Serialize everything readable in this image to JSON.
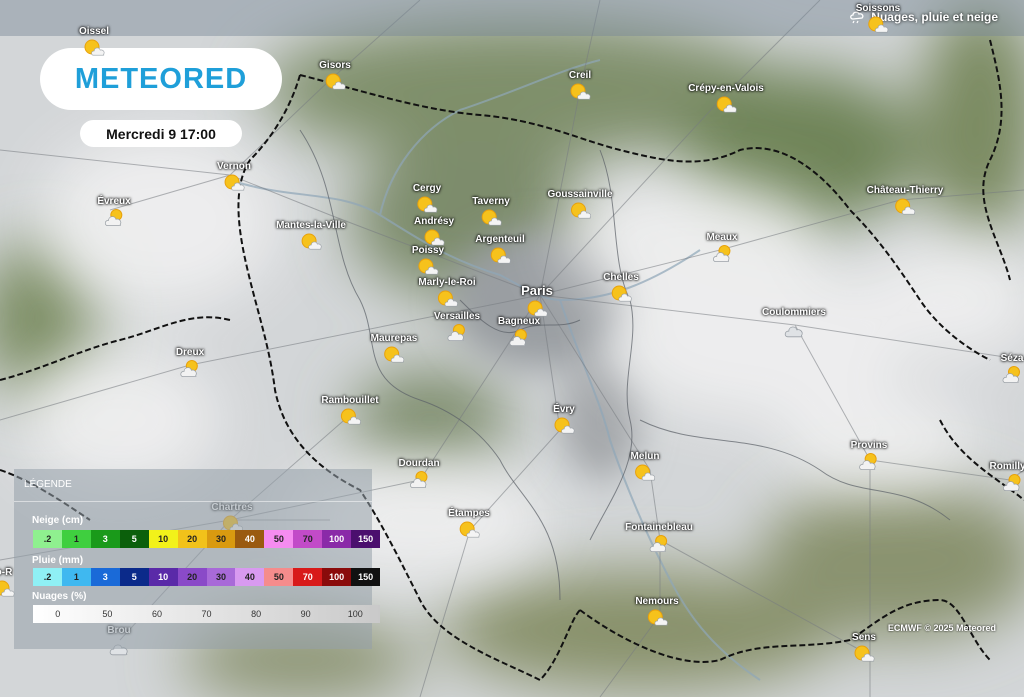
{
  "header": {
    "layer_title": "Nuages, pluie et neige",
    "layer_icon": "cloud-rain-icon",
    "logo_text": "METEORED",
    "datetime": "Mercredi 9 17:00"
  },
  "cities": [
    {
      "name": "Oissel",
      "icon": "sun-cloud-icon"
    },
    {
      "name": "Gisors",
      "icon": "sun-cloud-icon"
    },
    {
      "name": "Creil",
      "icon": "sun-cloud-icon"
    },
    {
      "name": "Crépy-en-Valois",
      "icon": "sun-cloud-icon"
    },
    {
      "name": "Soissons",
      "icon": "sun-cloud-icon"
    },
    {
      "name": "Vernon",
      "icon": "sun-cloud-icon"
    },
    {
      "name": "Évreux",
      "icon": "cloud-sun-icon"
    },
    {
      "name": "Cergy",
      "icon": "sun-cloud-icon"
    },
    {
      "name": "Taverny",
      "icon": "sun-cloud-icon"
    },
    {
      "name": "Goussainville",
      "icon": "sun-cloud-icon"
    },
    {
      "name": "Château-Thierry",
      "icon": "sun-cloud-icon"
    },
    {
      "name": "Mantes-la-Ville",
      "icon": "sun-cloud-icon"
    },
    {
      "name": "Andrésy",
      "icon": "sun-cloud-icon"
    },
    {
      "name": "Argenteuil",
      "icon": "sun-cloud-icon"
    },
    {
      "name": "Meaux",
      "icon": "cloud-sun-icon"
    },
    {
      "name": "Poissy",
      "icon": "sun-cloud-icon"
    },
    {
      "name": "Marly-le-Roi",
      "icon": "sun-cloud-icon"
    },
    {
      "name": "Paris",
      "icon": "sun-cloud-icon"
    },
    {
      "name": "Chelles",
      "icon": "sun-cloud-icon"
    },
    {
      "name": "Versailles",
      "icon": "cloud-sun-icon"
    },
    {
      "name": "Bagneux",
      "icon": "cloud-sun-icon"
    },
    {
      "name": "Coulommiers",
      "icon": "cloud-icon"
    },
    {
      "name": "Maurepas",
      "icon": "sun-cloud-icon"
    },
    {
      "name": "Dreux",
      "icon": "cloud-sun-icon"
    },
    {
      "name": "Séza",
      "icon": "cloud-sun-icon"
    },
    {
      "name": "Rambouillet",
      "icon": "sun-cloud-icon"
    },
    {
      "name": "Évry",
      "icon": "sun-cloud-icon"
    },
    {
      "name": "Provins",
      "icon": "cloud-sun-icon"
    },
    {
      "name": "Dourdan",
      "icon": "cloud-sun-icon"
    },
    {
      "name": "Melun",
      "icon": "sun-cloud-icon"
    },
    {
      "name": "Romilly-s",
      "icon": "cloud-sun-icon"
    },
    {
      "name": "Chartres",
      "icon": "sun-cloud-icon"
    },
    {
      "name": "Étampes",
      "icon": "sun-cloud-icon"
    },
    {
      "name": "Fontainebleau",
      "icon": "cloud-sun-icon"
    },
    {
      "name": "Nemours",
      "icon": "sun-cloud-icon"
    },
    {
      "name": "Brou",
      "icon": "cloud-icon"
    },
    {
      "name": "Sens",
      "icon": "sun-cloud-icon"
    },
    {
      "name": "o-R",
      "icon": "sun-cloud-icon"
    }
  ],
  "legend": {
    "title": "LÉGENDE",
    "snow": {
      "label": "Neige (cm)",
      "steps": [
        {
          "v": ".2",
          "c": "#8ff08f"
        },
        {
          "v": "1",
          "c": "#3fcf3f"
        },
        {
          "v": "3",
          "c": "#1a9a1a"
        },
        {
          "v": "5",
          "c": "#0b5f0b"
        },
        {
          "v": "10",
          "c": "#f2f21a"
        },
        {
          "v": "20",
          "c": "#f2c21a"
        },
        {
          "v": "30",
          "c": "#d99a10"
        },
        {
          "v": "40",
          "c": "#9a5a10"
        },
        {
          "v": "50",
          "c": "#f58cf0"
        },
        {
          "v": "70",
          "c": "#c24bc8"
        },
        {
          "v": "100",
          "c": "#8a2aa8"
        },
        {
          "v": "150",
          "c": "#4b0f6e"
        }
      ]
    },
    "rain": {
      "label": "Pluie (mm)",
      "steps": [
        {
          "v": ".2",
          "c": "#8ff0f5"
        },
        {
          "v": "1",
          "c": "#3fb8f0"
        },
        {
          "v": "3",
          "c": "#1a6ad8"
        },
        {
          "v": "5",
          "c": "#0b2a8a"
        },
        {
          "v": "10",
          "c": "#5a2aa8"
        },
        {
          "v": "20",
          "c": "#8a4ac8"
        },
        {
          "v": "30",
          "c": "#a86ad8"
        },
        {
          "v": "40",
          "c": "#d89af0"
        },
        {
          "v": "50",
          "c": "#f58c8c"
        },
        {
          "v": "70",
          "c": "#d81a1a"
        },
        {
          "v": "100",
          "c": "#8a0b0b"
        },
        {
          "v": "150",
          "c": "#111111"
        }
      ]
    },
    "clouds": {
      "label": "Nuages (%)",
      "steps": [
        "0",
        "50",
        "60",
        "70",
        "80",
        "90",
        "100"
      ]
    }
  },
  "credit": "ECMWF © 2025 Meteored"
}
